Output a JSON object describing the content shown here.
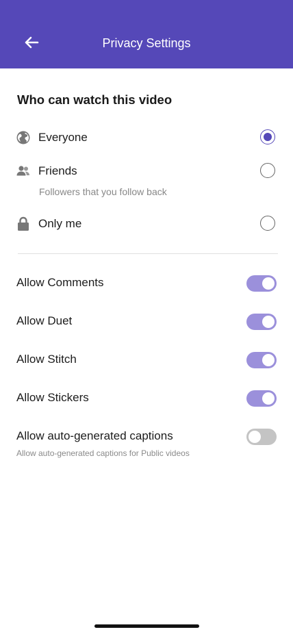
{
  "header": {
    "title": "Privacy Settings",
    "background": "#5548b8"
  },
  "audience": {
    "title": "Who can watch this video",
    "selected": "everyone",
    "options": [
      {
        "id": "everyone",
        "label": "Everyone",
        "icon": "globe-icon",
        "checked": true
      },
      {
        "id": "friends",
        "label": "Friends",
        "icon": "people-icon",
        "checked": false,
        "description": "Followers that you follow back"
      },
      {
        "id": "only_me",
        "label": "Only me",
        "icon": "lock-icon",
        "checked": false
      }
    ]
  },
  "toggles": [
    {
      "id": "comments",
      "label": "Allow Comments",
      "on": true
    },
    {
      "id": "duet",
      "label": "Allow Duet",
      "on": true
    },
    {
      "id": "stitch",
      "label": "Allow Stitch",
      "on": true
    },
    {
      "id": "stickers",
      "label": "Allow Stickers",
      "on": true
    },
    {
      "id": "captions",
      "label": "Allow auto-generated captions",
      "on": false,
      "description": "Allow auto-generated captions for Public videos"
    }
  ],
  "colors": {
    "accent": "#5548b8",
    "toggle_on": "#9b90db",
    "toggle_off": "#c4c4c4"
  }
}
